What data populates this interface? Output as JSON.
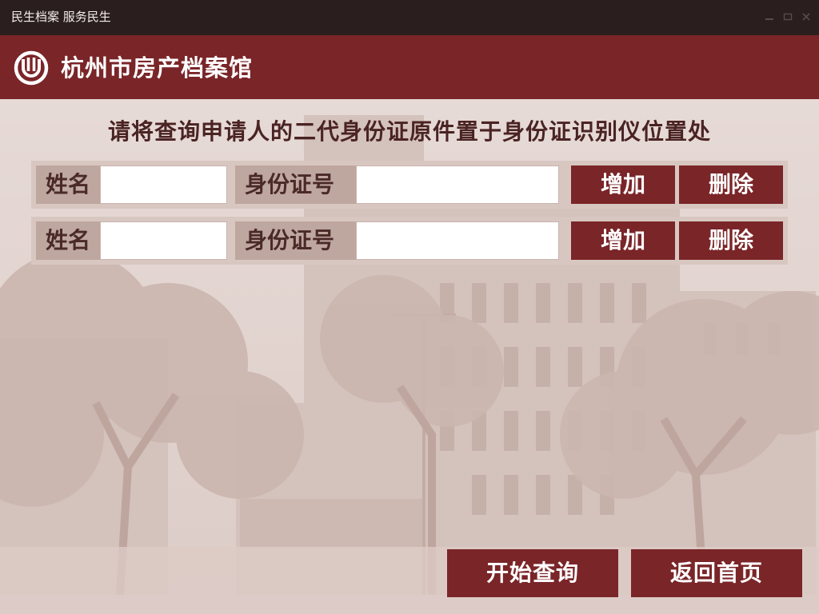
{
  "window": {
    "title": "民生档案 服务民生",
    "controls": [
      "minimize-icon",
      "maximize-icon",
      "close-icon"
    ]
  },
  "header": {
    "title": "杭州市房产档案馆",
    "logo_icon": "archive-logo-icon",
    "background": "#7a2528"
  },
  "instruction": "请将查询申请人的二代身份证原件置于身份证识别仪位置处",
  "applicant_rows": [
    {
      "name_label": "姓名",
      "name_value": "",
      "id_label": "身份证号",
      "id_value": "",
      "add_label": "增加",
      "delete_label": "删除"
    },
    {
      "name_label": "姓名",
      "name_value": "",
      "id_label": "身份证号",
      "id_value": "",
      "add_label": "增加",
      "delete_label": "删除"
    }
  ],
  "actions": {
    "start_query": "开始查询",
    "back_home": "返回首页"
  },
  "colors": {
    "accent": "#7a2528",
    "titlebar": "#2b1e1e",
    "label_bg": "#bea79f",
    "row_bg": "#d8c7c1",
    "instruction_text": "#4a2323"
  }
}
